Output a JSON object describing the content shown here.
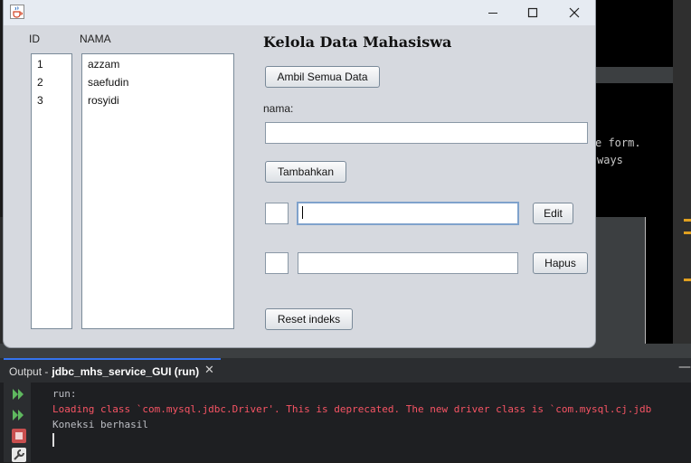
{
  "background": {
    "code_line_1": "e form.",
    "code_line_2": "ways"
  },
  "window": {
    "app_icon": "java-cup-icon",
    "minimize_icon": "minimize-icon",
    "maximize_icon": "maximize-icon",
    "close_icon": "close-icon"
  },
  "table": {
    "id_header": "ID",
    "name_header": "NAMA",
    "ids": [
      "1",
      "2",
      "3"
    ],
    "names": [
      "azzam",
      "saefudin",
      "rosyidi"
    ]
  },
  "form": {
    "title": "Kelola Data Mahasiswa",
    "fetch_all_button": "Ambil Semua Data",
    "name_label": "nama:",
    "name_value": "",
    "add_button": "Tambahkan",
    "edit_id_value": "",
    "edit_name_value": "",
    "edit_button": "Edit",
    "delete_id_value": "",
    "delete_name_value": "",
    "delete_button": "Hapus",
    "reset_button": "Reset indeks"
  },
  "output": {
    "tab_prefix": "Output - ",
    "tab_name": "jdbc_mhs_service_GUI (run)",
    "close_glyph": "✕",
    "minimize_glyph": "—",
    "lines": [
      "run:",
      "Loading class `com.mysql.jdbc.Driver'. This is deprecated. The new driver class is `com.mysql.cj.jdb",
      "Koneksi berhasil"
    ],
    "colors": {
      "normal": "#bcbec4",
      "error": "#f75464"
    }
  }
}
